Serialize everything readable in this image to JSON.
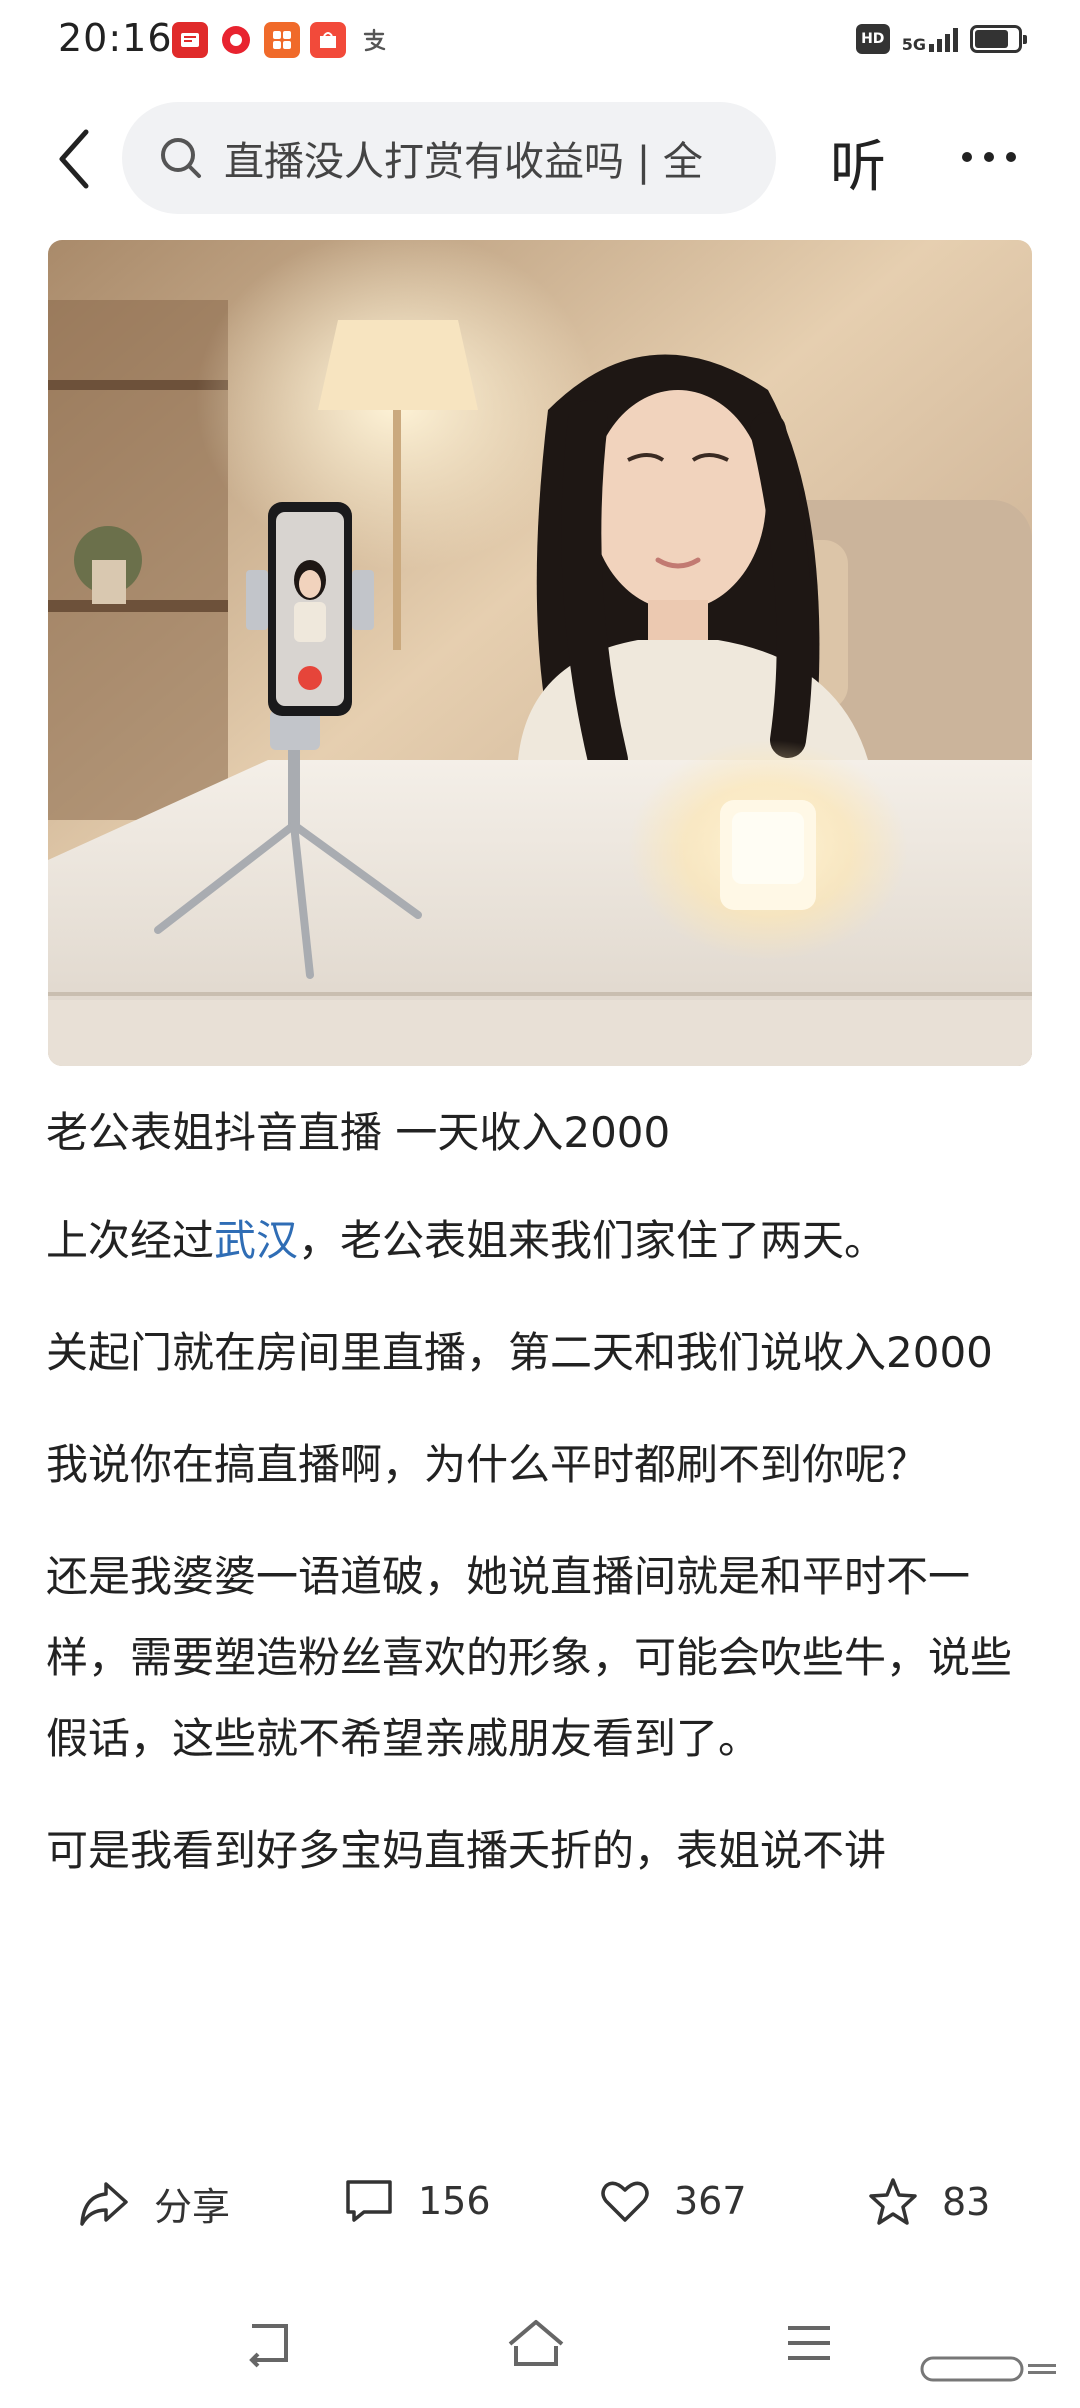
{
  "status_bar": {
    "time": "20:16",
    "network": "5G",
    "hd_badge": "HD"
  },
  "top_bar": {
    "search_text": "直播没人打赏有收益吗 | 全",
    "listen_label": "听"
  },
  "article": {
    "title": "老公表姐抖音直播 一天收入2000",
    "p1_before": "上次经过",
    "p1_link": "武汉",
    "p1_after": "，老公表姐来我们家住了两天。",
    "p2": "关起门就在房间里直播，第二天和我们说收入2000",
    "p3": "我说你在搞直播啊，为什么平时都刷不到你呢？",
    "p4": "还是我婆婆一语道破，她说直播间就是和平时不一样，需要塑造粉丝喜欢的形象，可能会吹些牛，说些假话，这些就不希望亲戚朋友看到了。",
    "p5": "可是我看到好多宝妈直播夭折的，表姐说不讲"
  },
  "actions": {
    "share_label": "分享",
    "comment_count": "156",
    "like_count": "367",
    "favorite_count": "83"
  },
  "colors": {
    "link": "#2f6db5",
    "search_bg": "#f1f2f4"
  }
}
